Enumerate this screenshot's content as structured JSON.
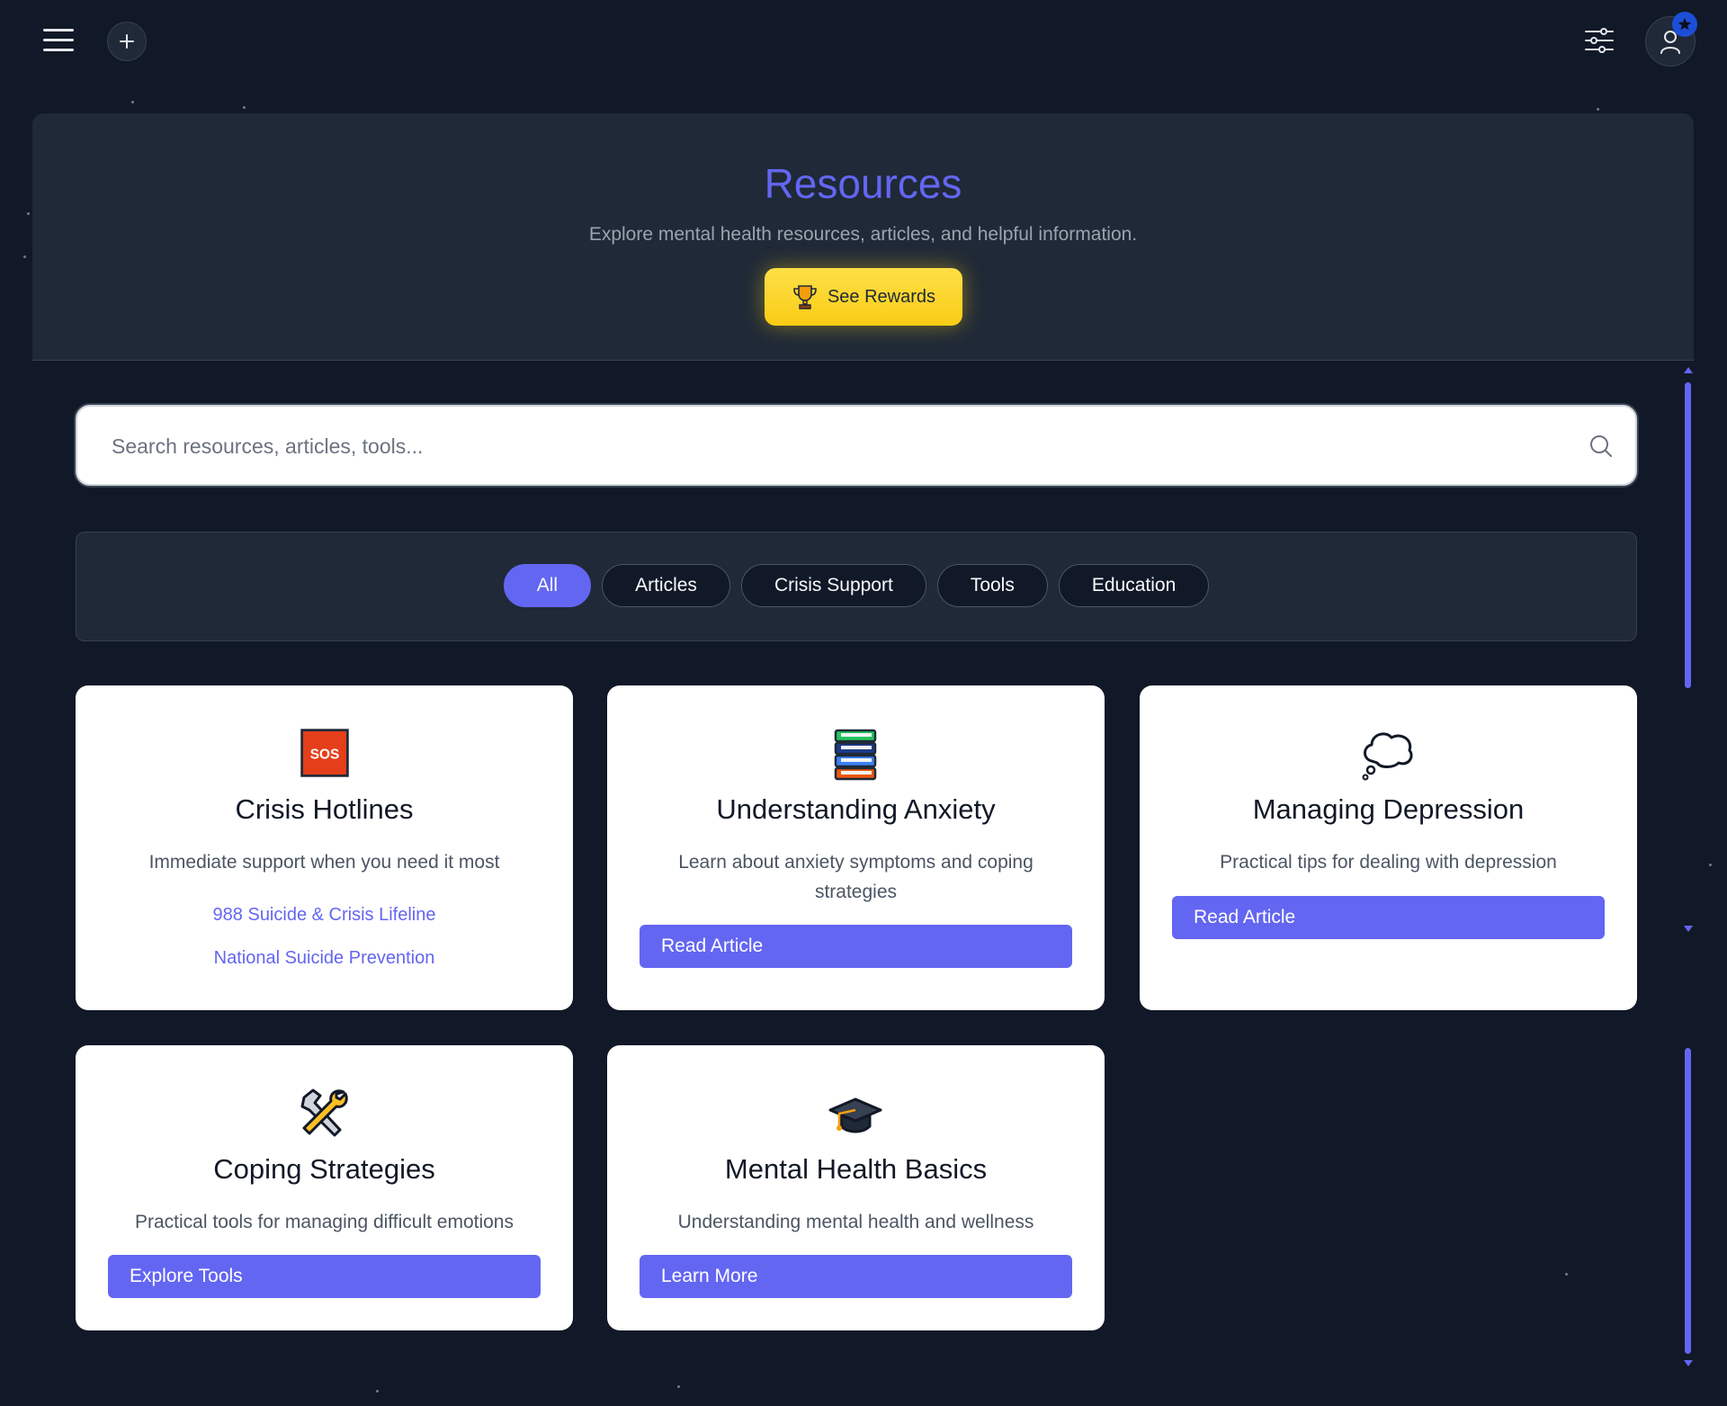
{
  "topbar": {
    "menu_icon": "hamburger-menu-icon",
    "add_icon": "plus-icon",
    "settings_icon": "sliders-icon",
    "profile_icon": "user-icon",
    "badge_icon": "star-icon"
  },
  "header": {
    "title": "Resources",
    "subtitle": "Explore mental health resources, articles, and helpful information.",
    "rewards_label": "See Rewards",
    "rewards_icon": "trophy-icon"
  },
  "search": {
    "placeholder": "Search resources, articles, tools...",
    "value": ""
  },
  "filters": {
    "items": [
      {
        "label": "All",
        "active": true
      },
      {
        "label": "Articles",
        "active": false
      },
      {
        "label": "Crisis Support",
        "active": false
      },
      {
        "label": "Tools",
        "active": false
      },
      {
        "label": "Education",
        "active": false
      }
    ]
  },
  "cards": [
    {
      "icon": "sos-icon",
      "icon_text": "SOS",
      "title": "Crisis Hotlines",
      "description": "Immediate support when you need it most",
      "links": [
        "988 Suicide & Crisis Lifeline",
        "National Suicide Prevention"
      ]
    },
    {
      "icon": "books-icon",
      "title": "Understanding Anxiety",
      "description": "Learn about anxiety symptoms and coping strategies",
      "button": "Read Article"
    },
    {
      "icon": "thought-bubble-icon",
      "title": "Managing Depression",
      "description": "Practical tips for dealing with depression",
      "button": "Read Article"
    },
    {
      "icon": "tools-icon",
      "title": "Coping Strategies",
      "description": "Practical tools for managing difficult emotions",
      "button": "Explore Tools"
    },
    {
      "icon": "graduation-cap-icon",
      "title": "Mental Health Basics",
      "description": "Understanding mental health and wellness",
      "button": "Learn More"
    }
  ],
  "colors": {
    "background": "#111827",
    "panel": "#1f2937",
    "accent": "#6366f1",
    "rewards": "#facc15"
  }
}
